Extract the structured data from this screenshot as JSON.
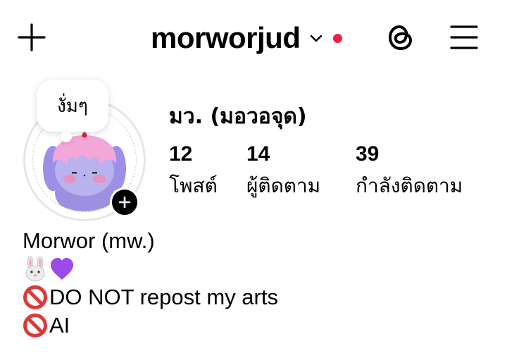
{
  "header": {
    "username": "morworjud",
    "icons": [
      "plus-icon",
      "chevron-down-icon",
      "notification-dot",
      "threads-icon",
      "menu-icon"
    ],
    "notification_color": "#ed1f45"
  },
  "profile": {
    "note": "งั่มๆ",
    "display_name": "มว. (มอวอจุด)",
    "stats": [
      {
        "value": "12",
        "label": "โพสต์"
      },
      {
        "value": "14",
        "label": "ผู้ติดตาม"
      },
      {
        "value": "39",
        "label": "กำลังติดตาม"
      }
    ]
  },
  "bio": {
    "name_line": "Morwor (mw.)",
    "emoji_line": [
      "rabbit-face-emoji",
      "purple-heart-emoji"
    ],
    "line3": "DO NOT repost my arts",
    "line4": "AI"
  }
}
